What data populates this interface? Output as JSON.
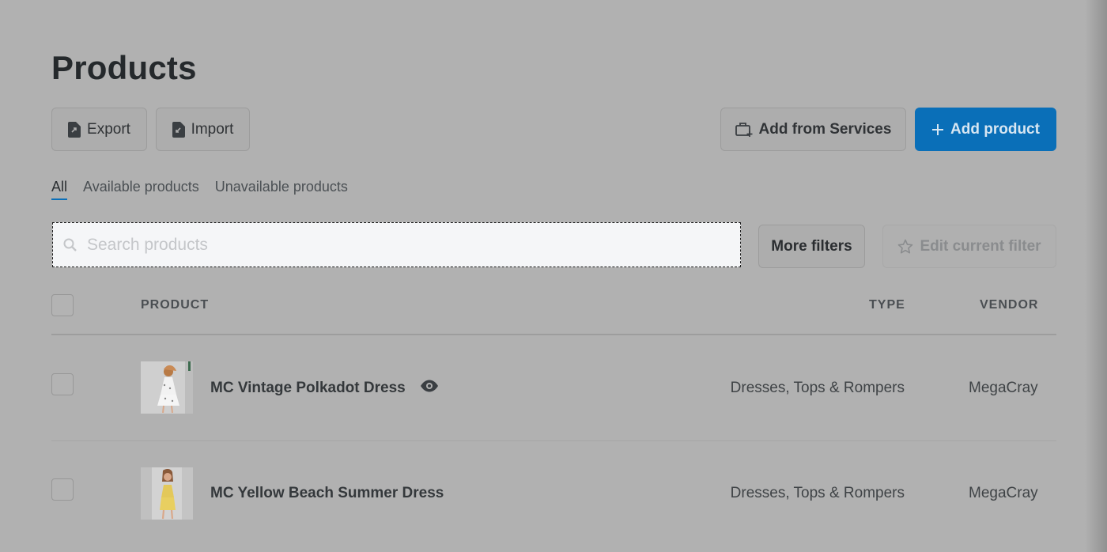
{
  "page": {
    "title": "Products"
  },
  "actions": {
    "export_label": "Export",
    "import_label": "Import",
    "add_from_services_label": "Add from Services",
    "add_product_label": "Add product"
  },
  "tabs": [
    {
      "label": "All",
      "active": true
    },
    {
      "label": "Available products",
      "active": false
    },
    {
      "label": "Unavailable products",
      "active": false
    }
  ],
  "search": {
    "placeholder": "Search products",
    "value": ""
  },
  "filters": {
    "more_filters_label": "More filters",
    "edit_filter_label": "Edit current filter"
  },
  "table": {
    "columns": [
      "PRODUCT",
      "TYPE",
      "VENDOR"
    ],
    "rows": [
      {
        "name": "MC Vintage Polkadot Dress",
        "type": "Dresses, Tops & Rompers",
        "vendor": "MegaCray",
        "preview_icon": "eye-icon"
      },
      {
        "name": "MC Yellow Beach Summer Dress",
        "type": "Dresses, Tops & Rompers",
        "vendor": "MegaCray"
      }
    ]
  },
  "colors": {
    "accent": "#0a6fb8",
    "overlay_bg": "#b1b1b1"
  }
}
